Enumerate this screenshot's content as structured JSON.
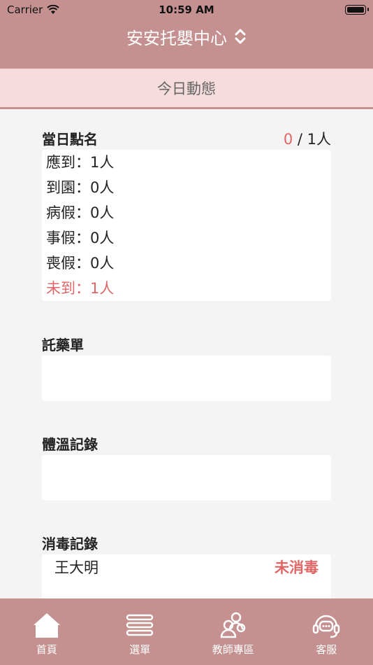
{
  "status_bar": {
    "carrier": "Carrier",
    "time": "10:59 AM"
  },
  "header": {
    "title": "安安托嬰中心"
  },
  "banner": {
    "label": "今日動態"
  },
  "attendance": {
    "title": "當日點名",
    "present": "0",
    "separator": " / ",
    "total": "1人",
    "rows": [
      {
        "text": "應到：1人"
      },
      {
        "text": "到園：0人"
      },
      {
        "text": "病假：0人"
      },
      {
        "text": "事假：0人"
      },
      {
        "text": "喪假：0人"
      },
      {
        "text": "未到：1人"
      }
    ]
  },
  "medicine": {
    "title": "託藥單"
  },
  "temperature": {
    "title": "體溫記錄"
  },
  "disinfection": {
    "title": "消毒記錄",
    "rows": [
      {
        "name": "王大明",
        "status": "未消毒"
      }
    ]
  },
  "tabbar": {
    "items": [
      {
        "label": "首頁",
        "icon": "home-icon"
      },
      {
        "label": "選單",
        "icon": "menu-icon"
      },
      {
        "label": "教師專區",
        "icon": "teachers-icon"
      },
      {
        "label": "客服",
        "icon": "support-headset-icon"
      }
    ]
  },
  "colors": {
    "header": "#c49090",
    "banner": "#f6dcdc",
    "alert": "#e06666",
    "background": "#f4f4f4"
  }
}
